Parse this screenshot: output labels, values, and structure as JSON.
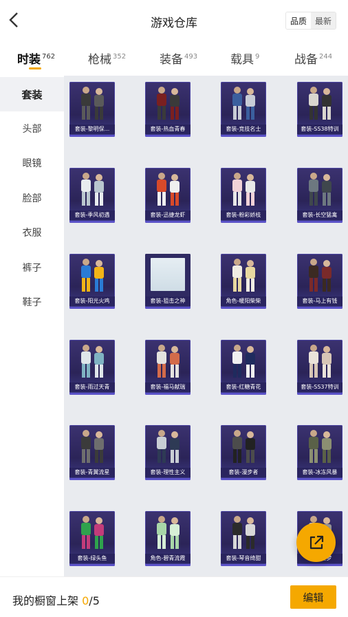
{
  "header": {
    "title": "游戏仓库",
    "sort_options": [
      "品质",
      "最新"
    ],
    "sort_selected": "品质"
  },
  "tabs": [
    {
      "label": "时装",
      "count": "762",
      "active": true
    },
    {
      "label": "枪械",
      "count": "352"
    },
    {
      "label": "装备",
      "count": "493"
    },
    {
      "label": "载具",
      "count": "9"
    },
    {
      "label": "战备",
      "count": "244"
    }
  ],
  "sidebar": {
    "items": [
      {
        "label": "套装",
        "active": true
      },
      {
        "label": "头部"
      },
      {
        "label": "眼镜"
      },
      {
        "label": "脸部"
      },
      {
        "label": "衣服"
      },
      {
        "label": "裤子"
      },
      {
        "label": "鞋子"
      }
    ]
  },
  "items": [
    {
      "label": "套装-黎明保..."
    },
    {
      "label": "套装-热血青春"
    },
    {
      "label": "套装-竞技名士"
    },
    {
      "label": "套装-SS38特训"
    },
    {
      "label": "套装-季风初遇"
    },
    {
      "label": "套装-迅捷龙虾"
    },
    {
      "label": "套装-粉彩娇枝"
    },
    {
      "label": "套装-长空猛禽"
    },
    {
      "label": "套装-阳光火鸡"
    },
    {
      "label": "套装-狙击之神",
      "placeholder": true
    },
    {
      "label": "角色-暖阳柴柴"
    },
    {
      "label": "套装-马上有钱"
    },
    {
      "label": "套装-雨过天青"
    },
    {
      "label": "套装-福马献瑞"
    },
    {
      "label": "套装-红糖青花"
    },
    {
      "label": "套装-SS37特训"
    },
    {
      "label": "套装-青翼流星"
    },
    {
      "label": "套装-理性主义"
    },
    {
      "label": "套装-漫步者"
    },
    {
      "label": "套装-冰冻风暴"
    },
    {
      "label": "套装-绿头鱼"
    },
    {
      "label": "角色-碧青流霞"
    },
    {
      "label": "套装-琴音绮甜"
    },
    {
      "label": "套装-星梦"
    }
  ],
  "bottom": {
    "showcase_label": "我的橱窗上架",
    "showcase_current": "0",
    "showcase_sep": "/",
    "showcase_total": "5",
    "edit_label": "编辑"
  },
  "colors": {
    "accent": "#f5a800",
    "card_bg": "#2b2458",
    "grid_bg": "#e9ebef"
  },
  "icons": {
    "back": "chevron-left-icon",
    "share": "external-link-icon"
  }
}
